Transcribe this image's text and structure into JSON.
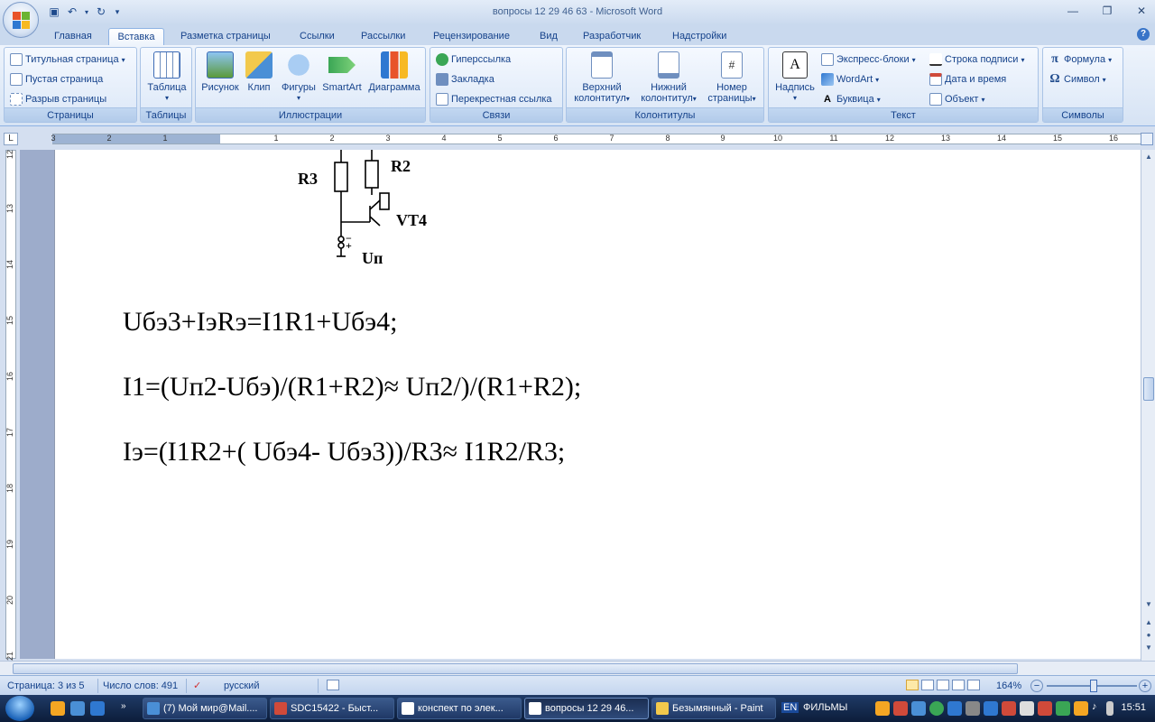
{
  "window": {
    "title": "вопросы 12 29 46 63 - Microsoft Word"
  },
  "tabs": [
    "Главная",
    "Вставка",
    "Разметка страницы",
    "Ссылки",
    "Рассылки",
    "Рецензирование",
    "Вид",
    "Разработчик",
    "Надстройки"
  ],
  "active_tab": "Вставка",
  "ribbon": {
    "pages": {
      "label": "Страницы",
      "cover": "Титульная страница",
      "blank": "Пустая страница",
      "break": "Разрыв страницы"
    },
    "tables": {
      "label": "Таблицы",
      "table": "Таблица"
    },
    "illustrations": {
      "label": "Иллюстрации",
      "picture": "Рисунок",
      "clip": "Клип",
      "shapes": "Фигуры",
      "smartart": "SmartArt",
      "chart": "Диаграмма"
    },
    "links": {
      "label": "Связи",
      "hyperlink": "Гиперссылка",
      "bookmark": "Закладка",
      "cross": "Перекрестная ссылка"
    },
    "headers": {
      "label": "Колонтитулы",
      "header_l1": "Верхний",
      "header_l2": "колонтитул",
      "footer_l1": "Нижний",
      "footer_l2": "колонтитул",
      "page_l1": "Номер",
      "page_l2": "страницы"
    },
    "text": {
      "label": "Текст",
      "textbox": "Надпись",
      "quick": "Экспресс-блоки",
      "wordart": "WordArt",
      "dropcap": "Буквица",
      "signature": "Строка подписи",
      "datetime": "Дата и время",
      "object": "Объект"
    },
    "symbols": {
      "label": "Символы",
      "equation": "Формула",
      "symbol": "Символ"
    }
  },
  "ruler": {
    "h_numbers": [
      "3",
      "2",
      "1",
      "1",
      "2",
      "3",
      "4",
      "5",
      "6",
      "7",
      "8",
      "9",
      "10",
      "11",
      "12",
      "13",
      "14",
      "15",
      "16"
    ],
    "v_numbers": [
      "12",
      "13",
      "14",
      "15",
      "16",
      "17",
      "18",
      "19",
      "20",
      "21"
    ]
  },
  "circuit": {
    "r3": "R3",
    "r2": "R2",
    "vt4": "VT4",
    "minus": "−",
    "plus": "+",
    "up": "Uп"
  },
  "document": {
    "line1": "Uбэ3+IэRэ=I1R1+Uбэ4;",
    "line2": "I1=(Uп2-Uбэ)/(R1+R2)≈ Uп2/)/(R1+R2);",
    "line3": "Iэ=(I1R2+( Uбэ4- Uбэ3))/R3≈ I1R2/R3;"
  },
  "status": {
    "page": "Страница: 3 из 5",
    "words": "Число слов: 491",
    "lang": "русский",
    "zoom": "164%"
  },
  "taskbar": {
    "tasks": [
      "(7) Мой мир@Mail....",
      "SDC15422 - Быст...",
      "конспект по элек...",
      "вопросы 12 29 46...",
      "Безымянный - Paint"
    ],
    "lang": "EN",
    "films": "ФИЛЬМЫ",
    "clock": "15:51"
  },
  "colors": {
    "accent": "#15428b",
    "ribbon_bg": "#dbe7f7",
    "taskbar_bg": "#0c1d3a"
  }
}
